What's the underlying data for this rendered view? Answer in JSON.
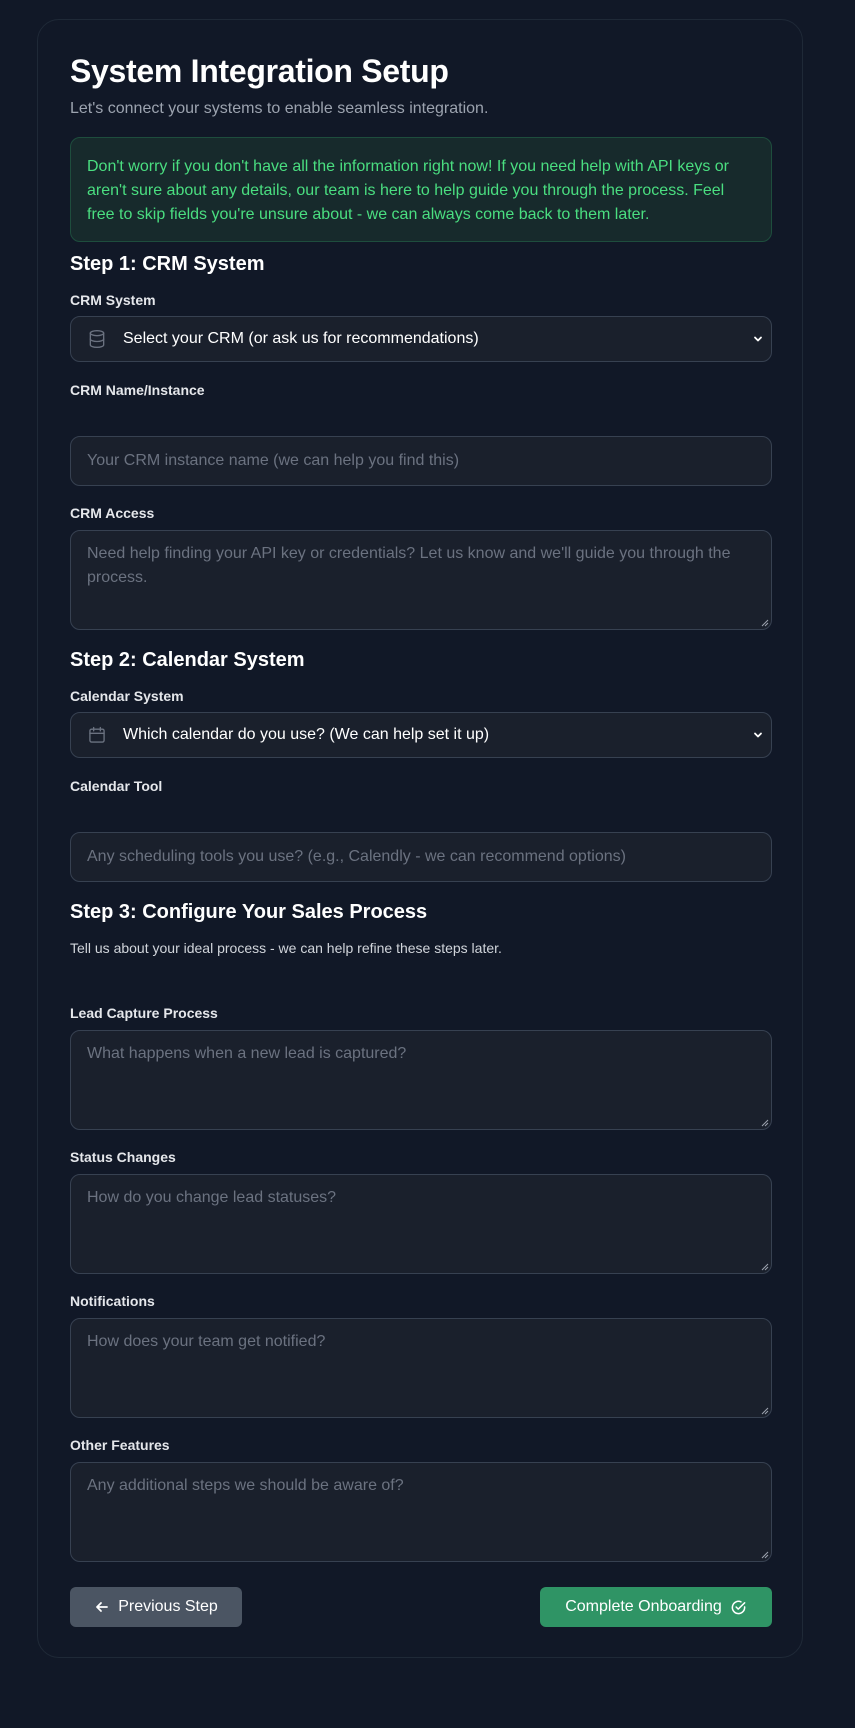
{
  "header": {
    "title": "System Integration Setup",
    "subtitle": "Let's connect your systems to enable seamless integration."
  },
  "notice": {
    "text": "Don't worry if you don't have all the information right now! If you need help with API keys or aren't sure about any details, our team is here to help guide you through the process. Feel free to skip fields you're unsure about - we can always come back to them later."
  },
  "step1": {
    "title": "Step 1: CRM System",
    "crm_system_label": "CRM System",
    "crm_system_value": "Select your CRM (or ask us for recommendations)",
    "crm_name_label": "CRM Name/Instance",
    "crm_name_placeholder": "Your CRM instance name (we can help you find this)",
    "crm_access_label": "CRM Access",
    "crm_access_placeholder": "Need help finding your API key or credentials? Let us know and we'll guide you through the process."
  },
  "step2": {
    "title": "Step 2: Calendar System",
    "calendar_system_label": "Calendar System",
    "calendar_system_value": "Which calendar do you use? (We can help set it up)",
    "calendar_tool_label": "Calendar Tool",
    "calendar_tool_placeholder": "Any scheduling tools you use? (e.g., Calendly - we can recommend options)"
  },
  "step3": {
    "title": "Step 3: Configure Your Sales Process",
    "helper": "Tell us about your ideal process - we can help refine these steps later.",
    "lead_capture_label": "Lead Capture Process",
    "lead_capture_placeholder": "What happens when a new lead is captured?",
    "status_changes_label": "Status Changes",
    "status_changes_placeholder": "How do you change lead statuses?",
    "notifications_label": "Notifications",
    "notifications_placeholder": "How does your team get notified?",
    "other_features_label": "Other Features",
    "other_features_placeholder": "Any additional steps we should be aware of?"
  },
  "actions": {
    "previous_label": "Previous Step",
    "complete_label": "Complete Onboarding"
  },
  "icons": {
    "crm": "database-icon",
    "calendar": "calendar-icon",
    "select_chevron": "chevron-down-icon",
    "previous": "arrow-left-icon",
    "complete": "check-circle-icon"
  },
  "colors": {
    "background": "#111827",
    "notice_text": "#4ade80",
    "primary_button": "#2f9465",
    "secondary_button": "#4b5563"
  }
}
